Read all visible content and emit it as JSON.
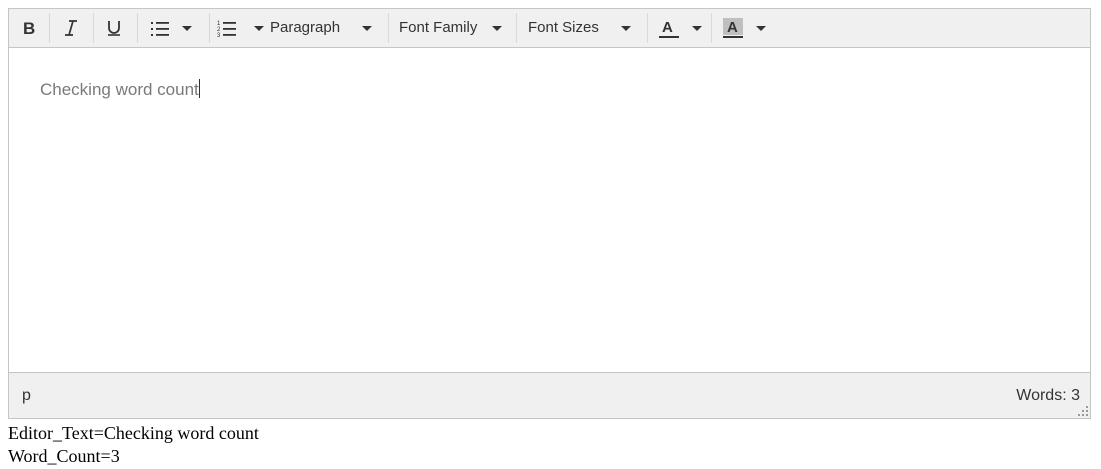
{
  "toolbar": {
    "bold_icon": "bold-icon",
    "italic_icon": "italic-icon",
    "underline_icon": "underline-icon",
    "bullet_list_icon": "bullet-list-icon",
    "numbered_list_icon": "numbered-list-icon",
    "block_format": "Paragraph",
    "font_family": "Font Family",
    "font_sizes": "Font Sizes",
    "text_color_icon": "text-color-icon",
    "background_color_icon": "background-color-icon"
  },
  "editor": {
    "content": "Checking word count"
  },
  "statusbar": {
    "path": "p",
    "word_count": "Words: 3"
  },
  "output": {
    "editor_text_line": "Editor_Text=Checking word count",
    "word_count_line": "Word_Count=3"
  },
  "colors": {
    "toolbar_bg": "#f0f0f0",
    "border": "#c5c5c5",
    "content_text": "#7a7a7a"
  }
}
